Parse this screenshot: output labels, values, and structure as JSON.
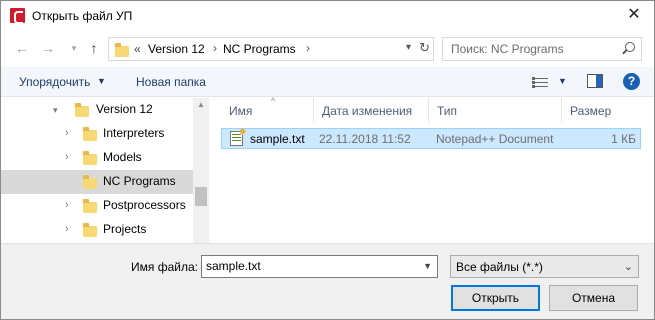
{
  "window": {
    "title": "Открыть файл УП",
    "close_symbol": "✕"
  },
  "address": {
    "prefix": "«",
    "crumbs": [
      "Version 12",
      "NC Programs"
    ],
    "separator": "›",
    "search_placeholder": "Поиск: NC Programs"
  },
  "toolbar": {
    "organize_label": "Упорядочить",
    "new_folder_label": "Новая папка",
    "help_label": "?"
  },
  "tree": {
    "items": [
      {
        "label": "Version 12",
        "expanded": true
      },
      {
        "label": "Interpreters"
      },
      {
        "label": "Models"
      },
      {
        "label": "NC Programs",
        "selected": true
      },
      {
        "label": "Postprocessors"
      },
      {
        "label": "Projects"
      }
    ]
  },
  "filelist": {
    "columns": [
      "Имя",
      "Дата изменения",
      "Тип",
      "Размер"
    ],
    "rows": [
      {
        "name": "sample.txt",
        "date": "22.11.2018 11:52",
        "type": "Notepad++ Document",
        "size": "1 КБ"
      }
    ]
  },
  "footer": {
    "filename_label": "Имя файла:",
    "filename_value": "sample.txt",
    "filter_value": "Все файлы (*.*)",
    "open_label": "Открыть",
    "cancel_label": "Отмена"
  },
  "colors": {
    "selection": "#cce8ff",
    "accent": "#0078d7",
    "app_icon": "#d21c2c"
  }
}
